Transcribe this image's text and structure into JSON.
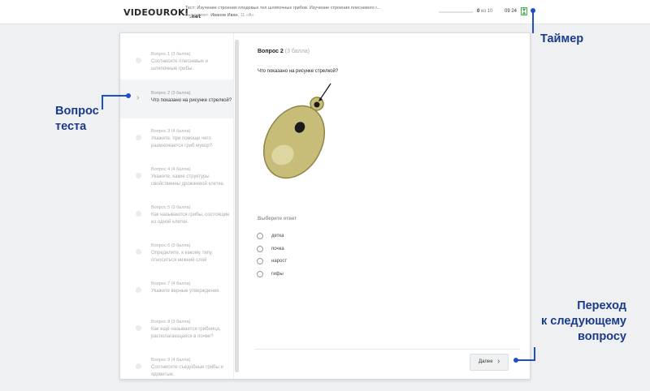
{
  "header": {
    "logo_main": "VIDEOUROKI",
    "logo_o": "",
    "logo_sub": ".net",
    "test_title": "Тест: Изучение строения плодовых тел шляпочных грибов. Изучение строения плесневого г...",
    "author_label": "Выполняет:",
    "author_name": "Иванов Иван",
    "author_class": ", 11 «А»",
    "progress_done": "0",
    "progress_of": "из 10",
    "progress_fraction": 0,
    "timer": "09 24"
  },
  "sidebar": {
    "questions": [
      {
        "num": "Вопрос 1 (3 балла)",
        "text": "Соотнесите плесневые и шляпочные грибы."
      },
      {
        "num": "Вопрос 2 (3 балла)",
        "text": "Что показано на рисунке стрелкой?",
        "active": true
      },
      {
        "num": "Вопрос 3 (4 балла)",
        "text": "Укажите, при помощи чего размножается гриб мукор?"
      },
      {
        "num": "Вопрос 4 (4 балла)",
        "text": "Укажите, какие структуры свойственны дрожжевой клетке."
      },
      {
        "num": "Вопрос 5 (3 балла)",
        "text": "Как называются грибы, состоящие из одной клетки."
      },
      {
        "num": "Вопрос 6 (3 балла)",
        "text": "Определите, к какому типу относиться нижний слой"
      },
      {
        "num": "Вопрос 7 (4 балла)",
        "text": "Укажите верные утверждения."
      },
      {
        "num": "Вопрос 8 (3 балла)",
        "text": "Как ещё называется грибница, располагающаяся в почве?"
      },
      {
        "num": "Вопрос 9 (4 балла)",
        "text": "Соотнесите съедобные грибы и ядовитые."
      }
    ]
  },
  "question": {
    "number": "Вопрос 2",
    "points": "(3 балла)",
    "prompt": "Что показано на рисунке стрелкой?",
    "choose_label": "Выберите ответ",
    "options": [
      "детка",
      "почка",
      "нарост",
      "гифы"
    ],
    "next_label": "Далее"
  },
  "annotations": {
    "timer": "Таймер",
    "question_line1": "Вопрос",
    "question_line2": "теста",
    "next_line1": "Переход",
    "next_line2": "к следующему",
    "next_line3": "вопросу"
  },
  "colors": {
    "annotation": "#1e4fc9",
    "annotation_text": "#1a3a8c",
    "timer_icon": "#4caf50",
    "logo_accent": "#e53935"
  }
}
